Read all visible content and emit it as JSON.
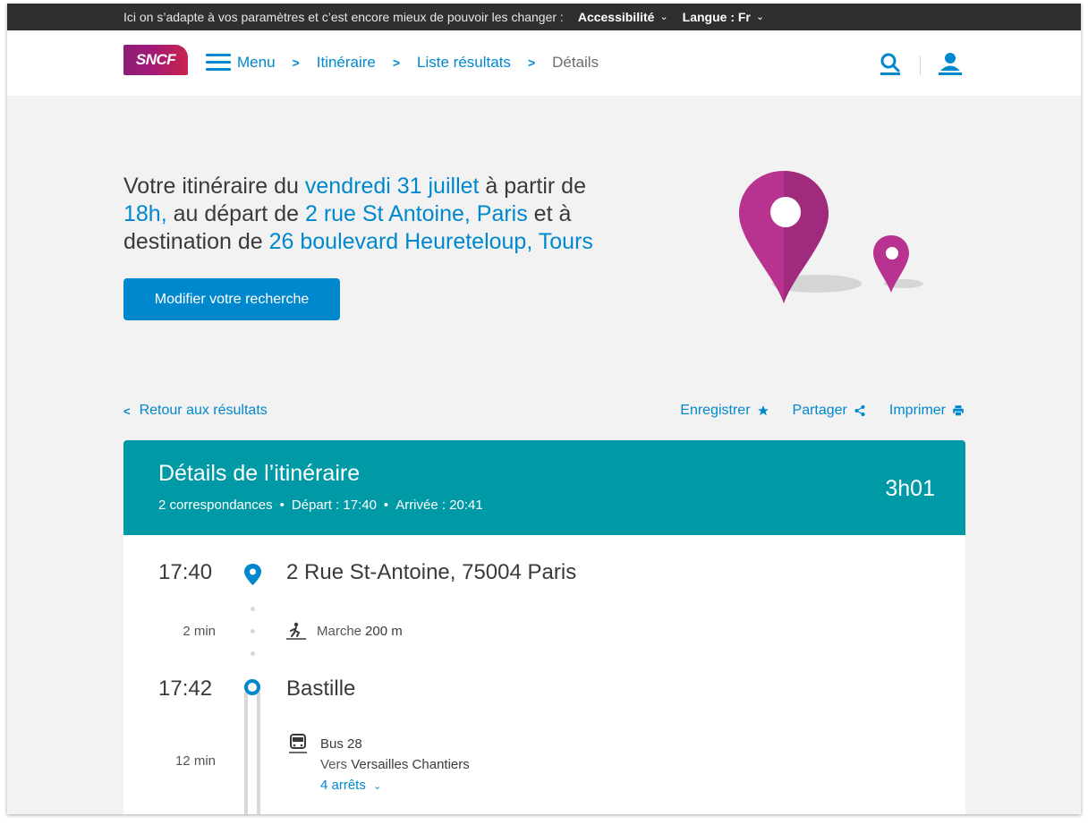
{
  "topbar": {
    "message": "Ici on s’adapte à vos paramètres et c’est encore mieux de pouvoir les changer :",
    "accessibility_label": "Accessibilité",
    "language_label": "Langue : Fr"
  },
  "header": {
    "logo_text": "SNCF",
    "breadcrumbs": [
      {
        "label": "Menu"
      },
      {
        "label": "Itinéraire"
      },
      {
        "label": "Liste résultats"
      },
      {
        "label": "Détails"
      }
    ]
  },
  "hero": {
    "line1_a": "Votre itinéraire du ",
    "date": "vendredi 31 juillet",
    "line1_b": " à partir de",
    "time": "18h,",
    "line2_a": " au départ de ",
    "origin": "2 rue St Antoine, Paris",
    "line2_b": " et à",
    "line3_a": "destination de ",
    "destination": "26 boulevard Heureteloup, Tours",
    "modify_button": "Modifier votre recherche"
  },
  "actions": {
    "back_label": "Retour aux résultats",
    "save_label": "Enregistrer",
    "share_label": "Partager",
    "print_label": "Imprimer"
  },
  "details": {
    "title": "Détails de l’itinéraire",
    "connections": "2 correspondances",
    "departure": "Départ : 17:40",
    "arrival": "Arrivée : 20:41",
    "duration": "3h01",
    "steps": {
      "origin_time": "17:40",
      "origin_name": "2 Rue St-Antoine, 75004 Paris",
      "walk_duration": "2 min",
      "walk_label": "Marche",
      "walk_distance": "200 m",
      "stop_time": "17:42",
      "stop_name": "Bastille",
      "bus_duration": "12 min",
      "bus_line": "Bus 28",
      "bus_direction_prefix": "Vers",
      "bus_direction": "Versailles Chantiers",
      "bus_stops": "4 arrêts"
    }
  },
  "colors": {
    "accent_blue": "#0088ce",
    "teal_header": "#009aa6",
    "pin_magenta": "#b7338f",
    "topbar_bg": "#2f2f2f"
  }
}
